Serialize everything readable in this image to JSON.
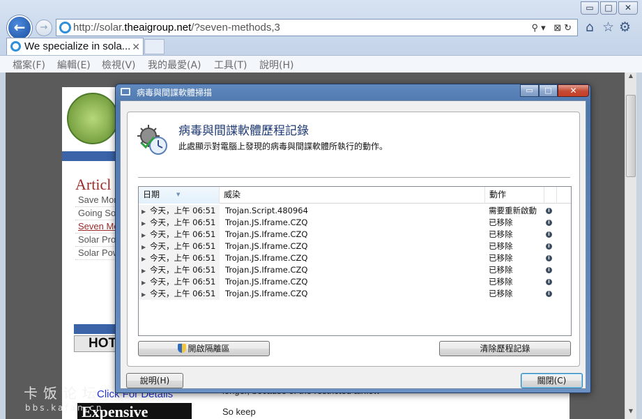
{
  "browser": {
    "window_controls": [
      "▭",
      "□",
      "✕"
    ],
    "url_prefix": "http://solar.",
    "url_domain": "theaigroup.net",
    "url_path": "/?seven-methods,3",
    "address_tools": "⚲▾ ⊠↻",
    "tab_title": "We specialize in sola...",
    "tab_close": "✕",
    "menu": [
      "檔案(F)",
      "編輯(E)",
      "檢視(V)",
      "我的最愛(A)",
      "工具(T)",
      "說明(H)"
    ]
  },
  "website": {
    "article_title": "Articl",
    "side_links": [
      "Save Mon",
      "Going Sol",
      "Seven Me",
      "Solar Proj",
      "Solar Pow"
    ],
    "hot": "HOT",
    "click_details": "Click For Details",
    "expensive": "Expensive",
    "body_text": "longer, because of the restricted airflow",
    "so_keep": "So keep"
  },
  "watermark": {
    "main": "卡饭论坛",
    "sub": "bbs.kafan.cn"
  },
  "dialog": {
    "window_title": "病毒與間諜軟體掃描",
    "title_min": "▭",
    "title_max": "□",
    "title_close": "✕",
    "heading": "病毒與間諜軟體歷程記錄",
    "description": "此處顯示對電腦上發現的病毒與間諜軟體所執行的動作。",
    "columns": {
      "date": "日期",
      "threat": "威染",
      "action": "動作"
    },
    "rows": [
      {
        "date": "今天，上午 06:51",
        "threat": "Trojan.Script.480964",
        "action": "需要重新啟動"
      },
      {
        "date": "今天，上午 06:51",
        "threat": "Trojan.JS.Iframe.CZQ",
        "action": "已移除"
      },
      {
        "date": "今天，上午 06:51",
        "threat": "Trojan.JS.Iframe.CZQ",
        "action": "已移除"
      },
      {
        "date": "今天，上午 06:51",
        "threat": "Trojan.JS.Iframe.CZQ",
        "action": "已移除"
      },
      {
        "date": "今天，上午 06:51",
        "threat": "Trojan.JS.Iframe.CZQ",
        "action": "已移除"
      },
      {
        "date": "今天，上午 06:51",
        "threat": "Trojan.JS.Iframe.CZQ",
        "action": "已移除"
      },
      {
        "date": "今天，上午 06:51",
        "threat": "Trojan.JS.Iframe.CZQ",
        "action": "已移除"
      },
      {
        "date": "今天，上午 06:51",
        "threat": "Trojan.JS.Iframe.CZQ",
        "action": "已移除"
      }
    ],
    "info_glyph": "i",
    "btn_quarantine": "開啟隔離區",
    "btn_clear": "清除歷程記錄",
    "btn_help": "說明(H)",
    "btn_close": "關閉(C)"
  },
  "colors": {
    "dialog_title_bar": "#4e77ae",
    "close_button": "#c44a33",
    "heading": "#1e3a73",
    "link": "#2233cc"
  }
}
